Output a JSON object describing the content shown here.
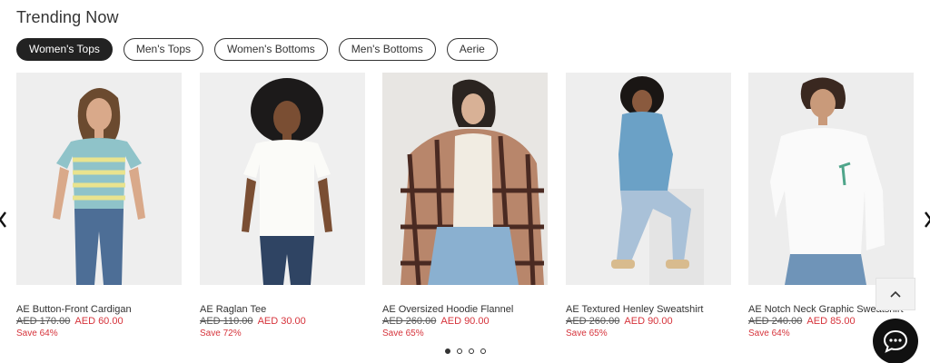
{
  "section": {
    "title": "Trending Now"
  },
  "tabs": [
    {
      "label": "Women's Tops",
      "active": true
    },
    {
      "label": "Men's Tops",
      "active": false
    },
    {
      "label": "Women's Bottoms",
      "active": false
    },
    {
      "label": "Men's Bottoms",
      "active": false
    },
    {
      "label": "Aerie",
      "active": false
    }
  ],
  "products": [
    {
      "name": "AE Button-Front Cardigan",
      "old_price": "AED 170.00",
      "new_price": "AED 60.00",
      "save": "Save 64%"
    },
    {
      "name": "AE Raglan Tee",
      "old_price": "AED 110.00",
      "new_price": "AED 30.00",
      "save": "Save 72%"
    },
    {
      "name": "AE Oversized Hoodie Flannel",
      "old_price": "AED 260.00",
      "new_price": "AED 90.00",
      "save": "Save 65%"
    },
    {
      "name": "AE Textured Henley Sweatshirt",
      "old_price": "AED 260.00",
      "new_price": "AED 90.00",
      "save": "Save 65%"
    },
    {
      "name": "AE Notch Neck Graphic Sweatshirt",
      "old_price": "AED 240.00",
      "new_price": "AED 85.00",
      "save": "Save 64%"
    }
  ],
  "carousel": {
    "prev_icon": "chevron-left-icon",
    "next_icon": "chevron-right-icon",
    "pages": 4,
    "current_page": 1
  },
  "colors": {
    "sale": "#d6333b",
    "active_tab_bg": "#222222",
    "chat_bg": "#111111"
  }
}
